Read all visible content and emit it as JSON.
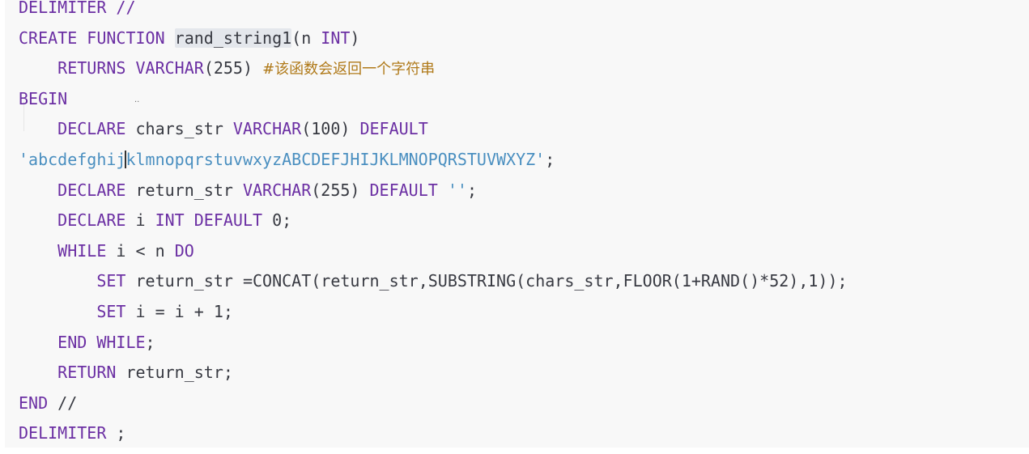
{
  "code_lines": {
    "l1": {
      "a": "DELIMITER //"
    },
    "l2": {
      "a": "CREATE FUNCTION",
      "b": " ",
      "c": "rand_string1",
      "d": "(n ",
      "e": "INT",
      "f": ")"
    },
    "l3": {
      "indent": "    ",
      "a": "RETURNS",
      "b": " ",
      "c": "VARCHAR",
      "d": "(255) ",
      "e": "#该函数会返回一个字符串"
    },
    "l4": {
      "a": "BEGIN"
    },
    "l5": {
      "indent": "    ",
      "a": "DECLARE",
      "b": " chars_str ",
      "c": "VARCHAR",
      "d": "(100) ",
      "e": "DEFAULT"
    },
    "l6": {
      "a": "'abcdefghij",
      "b": "klmnopqrstuvwxyzABCDEFJHIJKLMNOPQRSTUVWXYZ'",
      "c": ";"
    },
    "l7": {
      "indent": "    ",
      "a": "DECLARE",
      "b": " return_str ",
      "c": "VARCHAR",
      "d": "(255) ",
      "e": "DEFAULT",
      "f": " ",
      "g": "''",
      "h": ";"
    },
    "l8": {
      "indent": "    ",
      "a": "DECLARE",
      "b": " i ",
      "c": "INT",
      "d": " ",
      "e": "DEFAULT",
      "f": " 0;"
    },
    "l9": {
      "indent": "    ",
      "a": "WHILE",
      "b": " i < n ",
      "c": "DO"
    },
    "l10": {
      "indent": "        ",
      "a": "SET",
      "b": " return_str =",
      "c": "CONCAT",
      "d": "(return_str,",
      "e": "SUBSTRING",
      "f": "(chars_str,",
      "g": "FLOOR",
      "h": "(1+",
      "i": "RAND",
      "j": "()*52),1));"
    },
    "l11": {
      "indent": "        ",
      "a": "SET",
      "b": " i = i + 1;"
    },
    "l12": {
      "indent": "    ",
      "a": "END WHILE",
      "b": ";"
    },
    "l13": {
      "indent": "    ",
      "a": "RETURN",
      "b": " return_str;"
    },
    "l14": {
      "a": "END",
      "b": " //"
    },
    "l15": {
      "a": "DELIMITER",
      "b": " ;"
    }
  },
  "overlay": {
    "dots": ".."
  },
  "colors": {
    "keyword": "#6b2fa3",
    "string": "#4a8fc0",
    "comment": "#b07a1a",
    "identifier": "#383a42",
    "background": "#f8f8f8"
  }
}
